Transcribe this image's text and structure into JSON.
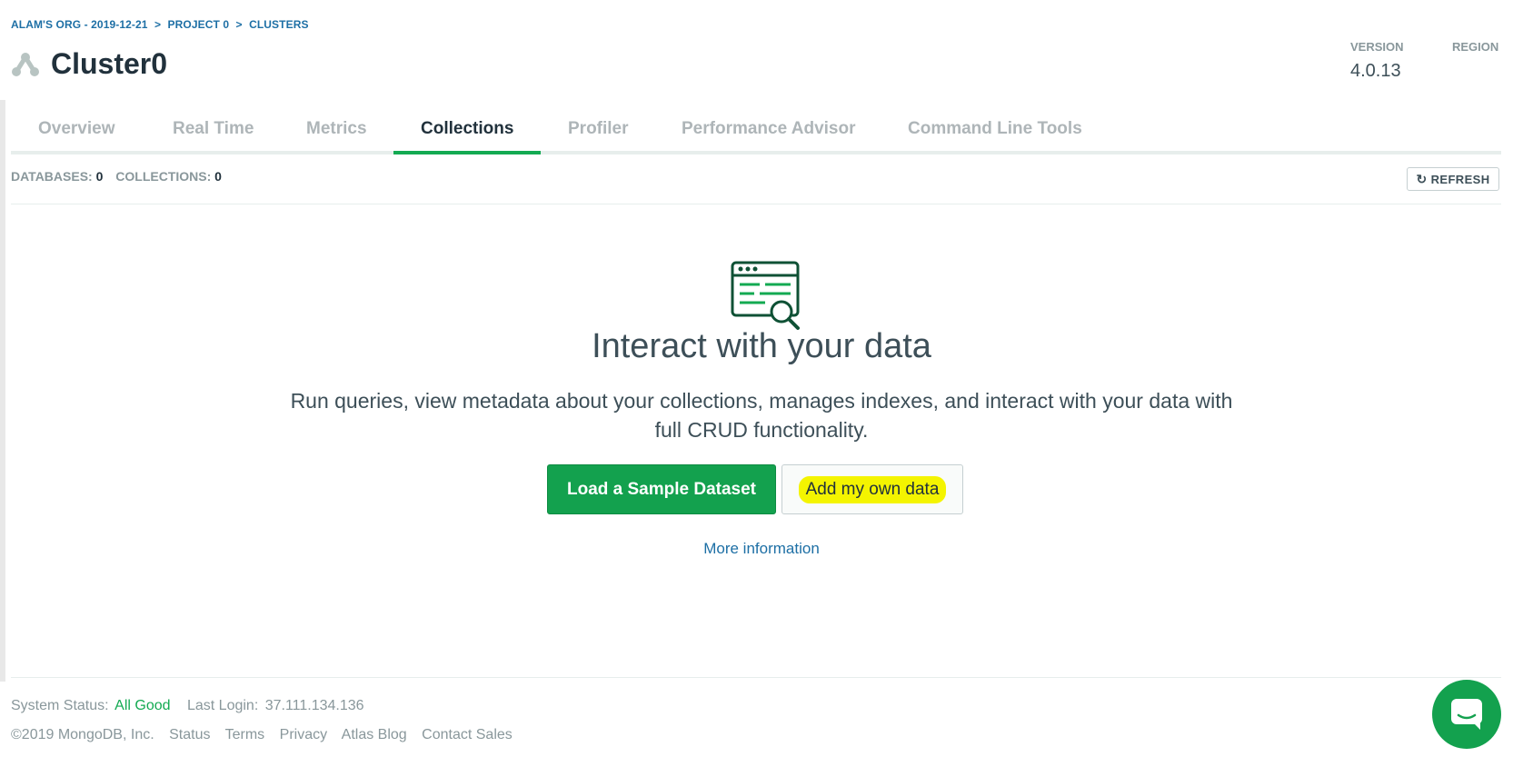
{
  "breadcrumb": {
    "org": "ALAM'S ORG - 2019-12-21",
    "sep1": ">",
    "project": "PROJECT 0",
    "sep2": ">",
    "section": "CLUSTERS"
  },
  "header": {
    "title": "Cluster0",
    "icon": "cluster-icon"
  },
  "meta": {
    "version_label": "VERSION",
    "version_value": "4.0.13",
    "region_label": "REGION"
  },
  "tabs": [
    {
      "label": "Overview",
      "active": false
    },
    {
      "label": "Real Time",
      "active": false
    },
    {
      "label": "Metrics",
      "active": false
    },
    {
      "label": "Collections",
      "active": true
    },
    {
      "label": "Profiler",
      "active": false
    },
    {
      "label": "Performance Advisor",
      "active": false
    },
    {
      "label": "Command Line Tools",
      "active": false
    }
  ],
  "stats": {
    "databases_label": "DATABASES:",
    "databases_value": "0",
    "collections_label": "COLLECTIONS:",
    "collections_value": "0"
  },
  "refresh": {
    "label": "REFRESH",
    "icon": "refresh-icon"
  },
  "empty_state": {
    "icon": "data-browser-search-icon",
    "title": "Interact with your data",
    "description": "Run queries, view metadata about your collections, manages indexes, and interact with your data with full CRUD functionality.",
    "primary_button": "Load a Sample Dataset",
    "secondary_button": "Add my own data",
    "more_info": "More information"
  },
  "footer": {
    "status_label": "System Status:",
    "status_value": "All Good",
    "last_login_label": "Last Login:",
    "last_login_value": "37.111.134.136",
    "links": [
      "©2019 MongoDB, Inc.",
      "Status",
      "Terms",
      "Privacy",
      "Atlas Blog",
      "Contact Sales"
    ]
  },
  "chat": {
    "icon": "chat-icon"
  },
  "colors": {
    "accent": "#13aa52",
    "button_green": "#13a14e",
    "link": "#1d6fa5",
    "highlight": "#f4f400"
  }
}
